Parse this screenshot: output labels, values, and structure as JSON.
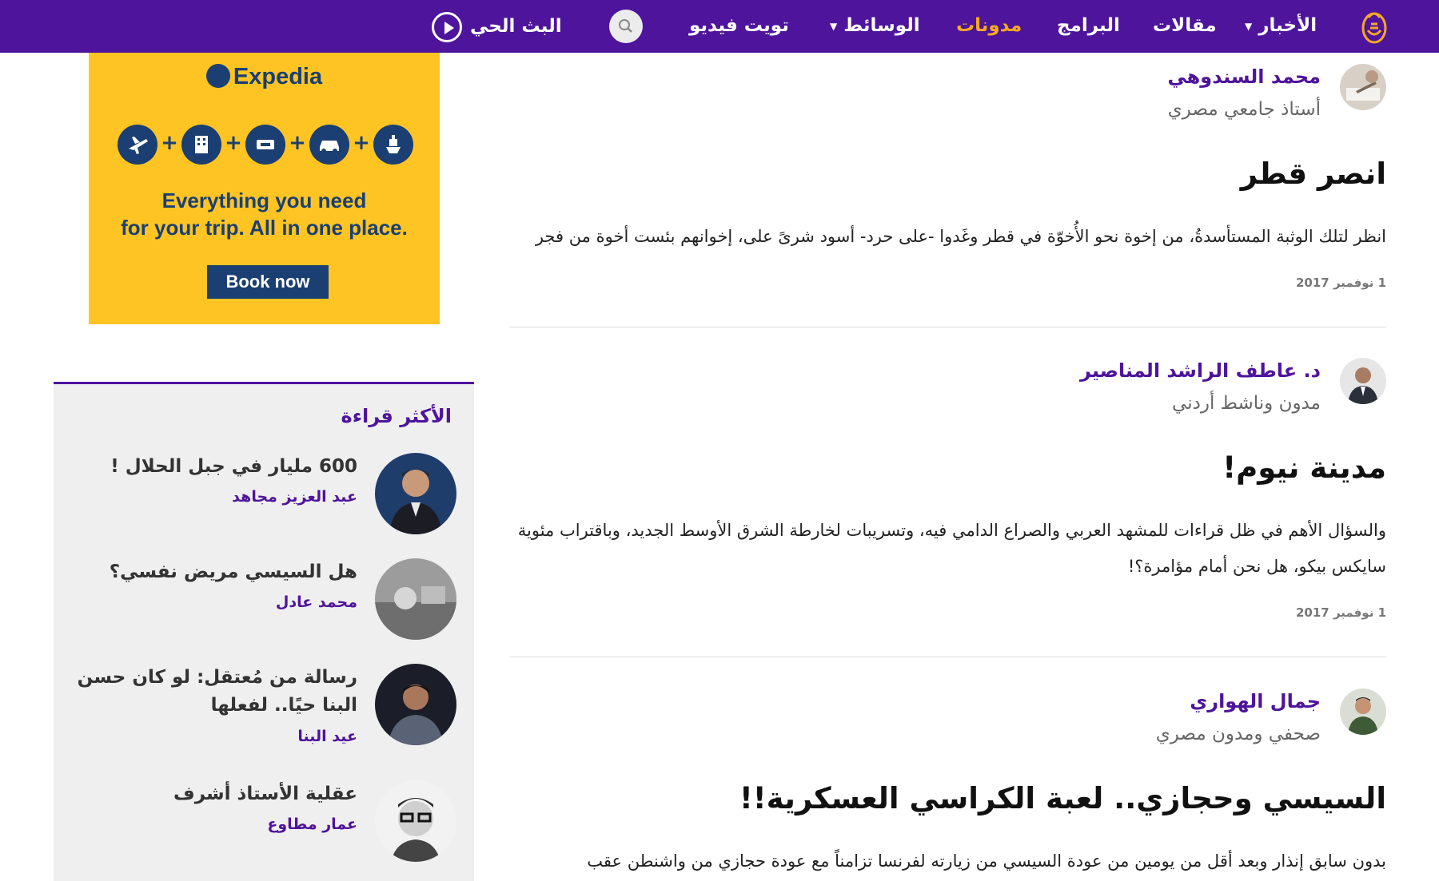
{
  "nav": {
    "items": [
      {
        "label": "الأخبار",
        "has_dropdown": true
      },
      {
        "label": "مقالات",
        "has_dropdown": false
      },
      {
        "label": "البرامج",
        "has_dropdown": false
      },
      {
        "label": "مدونات",
        "has_dropdown": false,
        "active": true
      },
      {
        "label": "الوسائط",
        "has_dropdown": true
      },
      {
        "label": "تويت فيديو",
        "has_dropdown": false
      }
    ],
    "live_label": "البث الحي",
    "colors": {
      "background": "#4e149c",
      "active": "#f6a923"
    }
  },
  "ad": {
    "brand": "Expedia",
    "tagline_line1": "Everything you need",
    "tagline_line2": "for your trip. All in one place.",
    "cta": "Book now",
    "icons": [
      "plane-icon",
      "hotel-icon",
      "ticket-icon",
      "car-icon",
      "cruise-icon"
    ],
    "colors": {
      "background": "#fdc424",
      "brand": "#1b3f72"
    }
  },
  "most_read": {
    "title": "الأكثر قراءة",
    "items": [
      {
        "headline": "600 مليار في جبل الحلال !",
        "author": "عبد العزيز مجاهد"
      },
      {
        "headline": "هل السيسي مريض نفسي؟",
        "author": "محمد عادل"
      },
      {
        "headline": "رسالة من مُعتقل: لو كان حسن البنا حيًا.. لفعلها",
        "author": "عيد البنا"
      },
      {
        "headline": "عقلية الأستاذ أشرف",
        "author": "عمار مطاوع"
      }
    ]
  },
  "posts": [
    {
      "author": "محمد السندوهي",
      "role": "أستاذ جامعي مصري",
      "title": "انصر قطر",
      "excerpt": "انظر لتلك الوثبة المستأسدةُ، من إخوة نحو الأُخوّة في قطر وغَدوا -على حرد- أسود شرىً على، إخوانهم بئست أخوة من فجر",
      "date": "1 نوفمبر 2017"
    },
    {
      "author": "د. عاطف الراشد المناصير",
      "role": "مدون وناشط أردني",
      "title": "مدينة نيوم!",
      "excerpt": "والسؤال الأهم في ظل قراءات للمشهد العربي والصراع الدامي فيه، وتسريبات لخارطة الشرق الأوسط الجديد، وباقتراب مئوية سايكس بيكو، هل نحن أمام مؤامرة؟!",
      "date": "1 نوفمبر 2017"
    },
    {
      "author": "جمال الهواري",
      "role": "صحفي ومدون مصري",
      "title": "السيسي وحجازي.. لعبة الكراسي العسكرية!!",
      "excerpt": "بدون سابق إنذار وبعد أقل من يومين من عودة السيسي من زيارته لفرنسا تزامناً مع عودة حجازي من واشنطن عقب"
    }
  ]
}
